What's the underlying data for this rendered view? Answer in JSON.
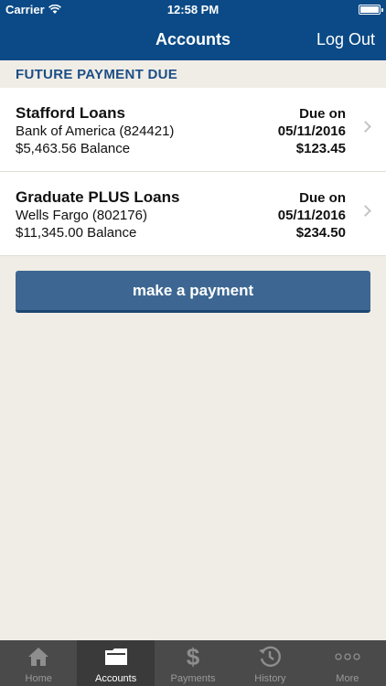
{
  "status_bar": {
    "carrier": "Carrier",
    "time": "12:58 PM"
  },
  "nav": {
    "title": "Accounts",
    "logout_label": "Log Out"
  },
  "section": {
    "title": "FUTURE PAYMENT DUE"
  },
  "loans": [
    {
      "name": "Stafford Loans",
      "lender": "Bank of America (824421)",
      "balance": "$5,463.56 Balance",
      "due_label": "Due on",
      "due_date": "05/11/2016",
      "due_amount": "$123.45"
    },
    {
      "name": "Graduate PLUS Loans",
      "lender": "Wells Fargo (802176)",
      "balance": "$11,345.00 Balance",
      "due_label": "Due on",
      "due_date": "05/11/2016",
      "due_amount": "$234.50"
    }
  ],
  "actions": {
    "pay_label": "make a payment"
  },
  "tabs": [
    {
      "label": "Home",
      "icon": "home-icon"
    },
    {
      "label": "Accounts",
      "icon": "folder-icon",
      "active": true
    },
    {
      "label": "Payments",
      "icon": "dollar-icon"
    },
    {
      "label": "History",
      "icon": "history-icon"
    },
    {
      "label": "More",
      "icon": "more-icon"
    }
  ],
  "colors": {
    "nav_bg": "#0b4a86",
    "accent": "#3d6792",
    "page_bg": "#f0ede6",
    "tab_bg": "#4a4a4a"
  }
}
